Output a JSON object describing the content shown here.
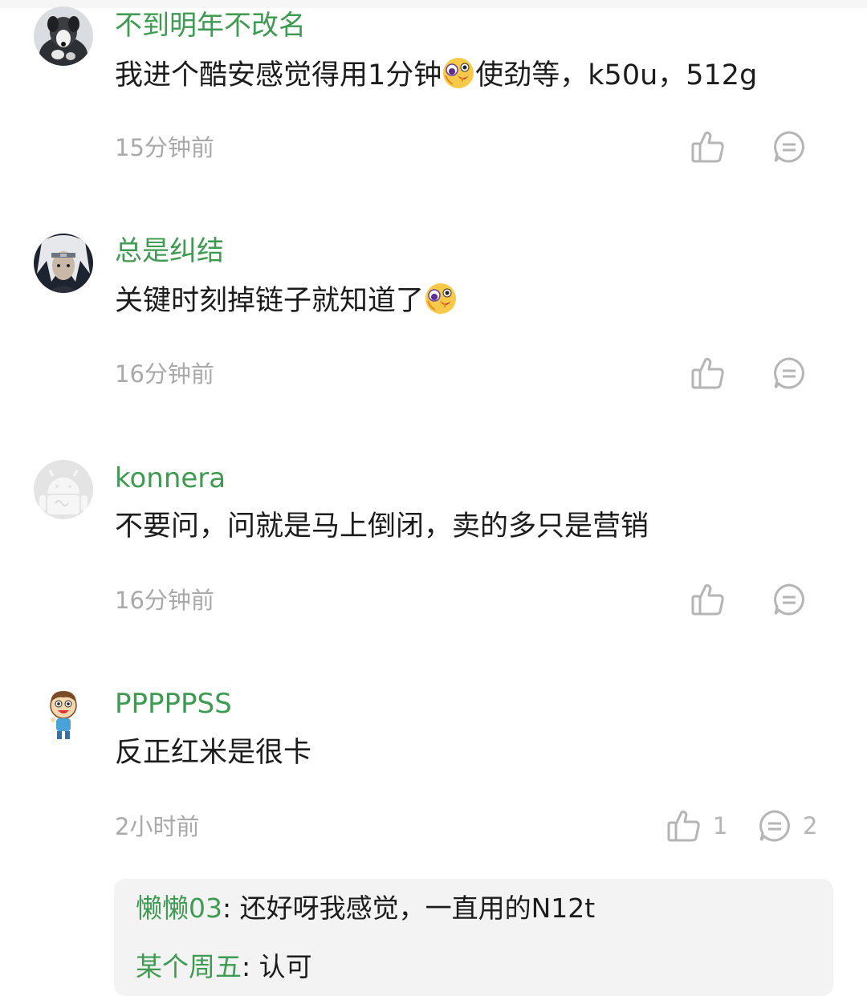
{
  "comments": [
    {
      "username": "不到明年不改名",
      "text_before": "我进个酷安感觉得用1分钟",
      "emoji": "crazy-face-emoji",
      "text_after": "使劲等，k50u，512g",
      "time": "15分钟前"
    },
    {
      "username": "总是纠结",
      "text_before": "关键时刻掉链子就知道了",
      "emoji": "crazy-face-emoji",
      "text_after": "",
      "time": "16分钟前"
    },
    {
      "username": "konnera",
      "text_before": "不要问，问就是马上倒闭，卖的多只是营销",
      "time": "16分钟前"
    },
    {
      "username": "PPPPPSS",
      "text_before": "反正红米是很卡",
      "time": "2小时前",
      "like_count": "1",
      "reply_count": "2",
      "replies": [
        {
          "user": "懒懒03",
          "sep": ": ",
          "text": "还好呀我感觉，一直用的N12t"
        },
        {
          "user": "某个周五",
          "sep": ": ",
          "text": "认可"
        }
      ]
    }
  ],
  "colors": {
    "username": "#3f9a52",
    "text": "#1c1c1c",
    "time": "#a9a9a9",
    "icon": "#b5b5b5",
    "reply_bg": "#f3f3f3"
  },
  "icons": {
    "like": "thumbs-up-icon",
    "reply": "comment-bubble-icon"
  }
}
